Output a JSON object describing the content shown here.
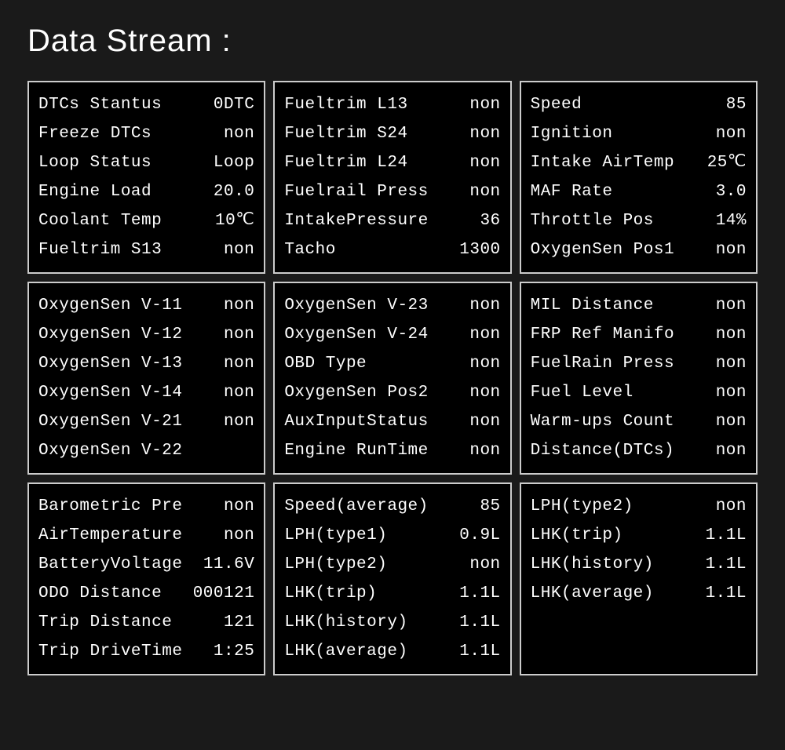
{
  "title": "Data Stream :",
  "panels": [
    [
      {
        "label": "DTCs  Stantus",
        "value": "0DTC"
      },
      {
        "label": "Freeze DTCs",
        "value": "non"
      },
      {
        "label": "Loop  Status",
        "value": "Loop"
      },
      {
        "label": "Engine Load",
        "value": "20.0"
      },
      {
        "label": "Coolant  Temp",
        "value": "10℃"
      },
      {
        "label": "Fueltrim S13",
        "value": "non"
      }
    ],
    [
      {
        "label": "Fueltrim L13",
        "value": "non"
      },
      {
        "label": "Fueltrim S24",
        "value": "non"
      },
      {
        "label": "Fueltrim L24",
        "value": "non"
      },
      {
        "label": "Fuelrail Press",
        "value": "non"
      },
      {
        "label": "IntakePressure",
        "value": "36"
      },
      {
        "label": "Tacho",
        "value": "1300"
      }
    ],
    [
      {
        "label": "Speed",
        "value": "85"
      },
      {
        "label": "Ignition",
        "value": "non"
      },
      {
        "label": "Intake AirTemp",
        "value": "25℃"
      },
      {
        "label": "MAF Rate",
        "value": "3.0"
      },
      {
        "label": "Throttle Pos",
        "value": "14%"
      },
      {
        "label": "OxygenSen Pos1",
        "value": "non"
      }
    ],
    [
      {
        "label": "OxygenSen V-11",
        "value": "non"
      },
      {
        "label": "OxygenSen V-12",
        "value": "non"
      },
      {
        "label": "OxygenSen V-13",
        "value": "non"
      },
      {
        "label": "OxygenSen V-14",
        "value": "non"
      },
      {
        "label": "OxygenSen V-21",
        "value": "non"
      },
      {
        "label": "OxygenSen V-22",
        "value": ""
      }
    ],
    [
      {
        "label": "OxygenSen V-23",
        "value": "non"
      },
      {
        "label": "OxygenSen V-24",
        "value": "non"
      },
      {
        "label": "OBD Type",
        "value": "non"
      },
      {
        "label": "OxygenSen Pos2",
        "value": "non"
      },
      {
        "label": "AuxInputStatus",
        "value": "non"
      },
      {
        "label": "Engine RunTime",
        "value": "non"
      }
    ],
    [
      {
        "label": "MIL   Distance",
        "value": "non"
      },
      {
        "label": "FRP Ref Manifo",
        "value": "non"
      },
      {
        "label": "FuelRain Press",
        "value": "non"
      },
      {
        "label": "Fuel Level",
        "value": "non"
      },
      {
        "label": "Warm-ups Count",
        "value": "non"
      },
      {
        "label": "Distance(DTCs)",
        "value": "non"
      }
    ],
    [
      {
        "label": "Barometric Pre",
        "value": "non"
      },
      {
        "label": "AirTemperature",
        "value": "non"
      },
      {
        "label": "BatteryVoltage",
        "value": "11.6V"
      },
      {
        "label": "ODO Distance",
        "value": "000121"
      },
      {
        "label": "Trip Distance",
        "value": "121"
      },
      {
        "label": "Trip DriveTime",
        "value": "1:25"
      }
    ],
    [
      {
        "label": "Speed(average)",
        "value": "85"
      },
      {
        "label": "LPH(type1)",
        "value": "0.9L"
      },
      {
        "label": "LPH(type2)",
        "value": "non"
      },
      {
        "label": "LHK(trip)",
        "value": "1.1L"
      },
      {
        "label": "LHK(history)",
        "value": "1.1L"
      },
      {
        "label": "LHK(average)",
        "value": "1.1L"
      }
    ],
    [
      {
        "label": "LPH(type2)",
        "value": "non"
      },
      {
        "label": "LHK(trip)",
        "value": "1.1L"
      },
      {
        "label": "LHK(history)",
        "value": "1.1L"
      },
      {
        "label": "LHK(average)",
        "value": "1.1L"
      },
      {
        "label": " ",
        "value": " "
      },
      {
        "label": " ",
        "value": " "
      }
    ]
  ]
}
